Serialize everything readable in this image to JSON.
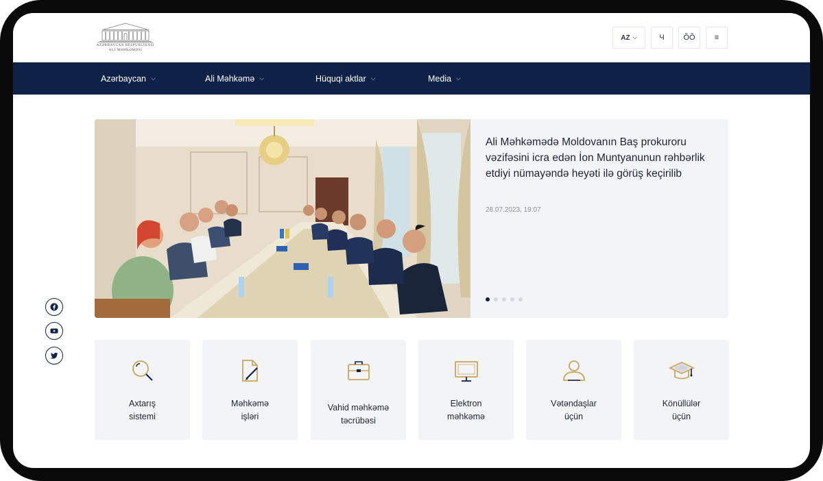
{
  "header": {
    "logo_line1": "AZƏRBAYCAN RESPUBLİKASI",
    "logo_line2": "ALİ MƏHKƏMƏSİ",
    "lang": "AZ",
    "search_glyph": "Ч",
    "glasses_glyph": "ÕÕ",
    "menu_glyph": "≡"
  },
  "nav": {
    "items": [
      {
        "label": "Azərbaycan"
      },
      {
        "label": "Ali Məhkəmə"
      },
      {
        "label": "Hüquqi aktlar"
      },
      {
        "label": "Media"
      }
    ]
  },
  "hero": {
    "headline": " Ali Məhkəmədə Moldovanın Baş prokuroru vəzifəsini icra edən İon Muntyanunun rəhbərlik etdiyi nümayəndə heyəti ilə görüş keçirilib",
    "date": "28.07.2023, 19:07",
    "slide_count": 5,
    "active_slide": 1
  },
  "social": [
    "facebook-icon",
    "youtube-icon",
    "twitter-icon"
  ],
  "services": [
    {
      "line1": "Axtarış",
      "line2": "sistemi",
      "icon": "search-icon"
    },
    {
      "line1": "Məhkəmə",
      "line2": "işləri",
      "icon": "document-edit-icon"
    },
    {
      "line1": "Vahid məhkəmə",
      "line2": "təcrübəsi",
      "icon": "briefcase-icon"
    },
    {
      "line1": "Elektron",
      "line2": "məhkəmə",
      "icon": "monitor-icon"
    },
    {
      "line1": "Vətəndaşlar",
      "line2": "üçün",
      "icon": "user-icon"
    },
    {
      "line1": "Könüllülər",
      "line2": "üçün",
      "icon": "graduation-cap-icon"
    }
  ],
  "colors": {
    "navy": "#0f2147",
    "gold": "#c9a45c",
    "card_bg": "#f3f4f7"
  }
}
